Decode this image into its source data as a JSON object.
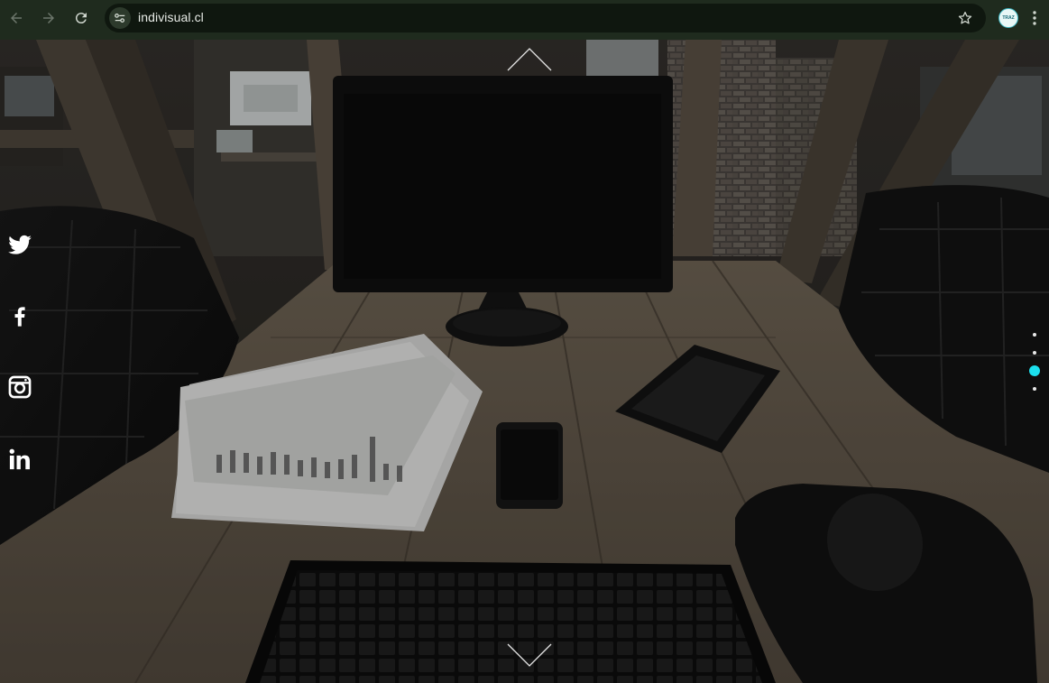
{
  "browser": {
    "url": "indivisual.cl",
    "profile_label": "TRAZ",
    "icons": [
      "back-arrow-icon",
      "forward-arrow-icon",
      "reload-icon",
      "site-settings-icon",
      "bookmark-star-icon",
      "menu-dots-icon"
    ]
  },
  "hero": {
    "social_links": [
      {
        "name": "twitter",
        "icon": "twitter-icon"
      },
      {
        "name": "facebook",
        "icon": "facebook-icon"
      },
      {
        "name": "instagram",
        "icon": "instagram-icon"
      },
      {
        "name": "linkedin",
        "icon": "linkedin-icon"
      }
    ],
    "pagination": {
      "total": 4,
      "active_index": 2
    },
    "colors": {
      "accent": "#1ce0ee",
      "chrome_bg": "#1f2b1e",
      "omnibox_bg": "#0f170f"
    }
  }
}
